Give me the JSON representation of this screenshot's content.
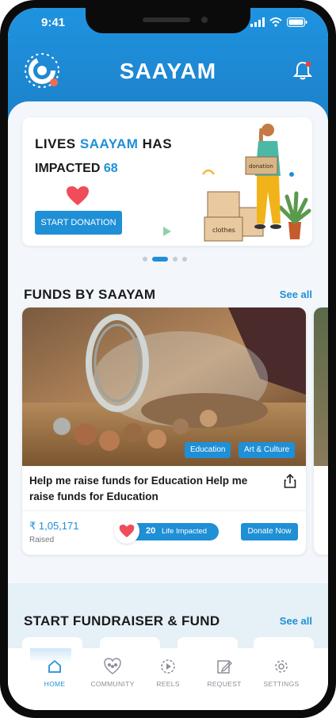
{
  "status_bar": {
    "time": "9:41"
  },
  "header": {
    "brand": "SAAYAM",
    "logo_icon": "saayam-logo-icon",
    "bell_icon": "bell-icon"
  },
  "banner": {
    "line1_prefix": "LIVES",
    "line1_accent": "SAAYAM",
    "line1_suffix": "HAS",
    "line2_prefix": "IMPACTED",
    "line2_count": "68",
    "button_label": "START DONATION",
    "box_label_1": "donation",
    "box_label_2": "clothes"
  },
  "carousel": {
    "total": 4,
    "active": 1
  },
  "funds_section": {
    "title": "FUNDS BY SAAYAM",
    "see_all": "See all"
  },
  "fund_card": {
    "tags": [
      "Education",
      "Art & Culture"
    ],
    "title": "Help me raise funds for Education Help me raise funds for Education",
    "amount": "₹ 1,05,171",
    "amount_label": "Raised",
    "impact_count": "20",
    "impact_label": "Life Impacted",
    "donate_label": "Donate Now"
  },
  "fundraiser_section": {
    "title": "START FUNDRAISER & FUND",
    "see_all": "See all"
  },
  "tab_bar": {
    "items": [
      {
        "label": "HOME",
        "icon": "home-icon",
        "active": true
      },
      {
        "label": "COMMUNITY",
        "icon": "community-icon",
        "active": false
      },
      {
        "label": "REELS",
        "icon": "reels-icon",
        "active": false
      },
      {
        "label": "REQUEST",
        "icon": "request-icon",
        "active": false
      },
      {
        "label": "SETTINGS",
        "icon": "settings-icon",
        "active": false
      }
    ]
  },
  "colors": {
    "primary": "#1f8fd6",
    "header": "#1f93e0",
    "text": "#1a1a1a"
  }
}
